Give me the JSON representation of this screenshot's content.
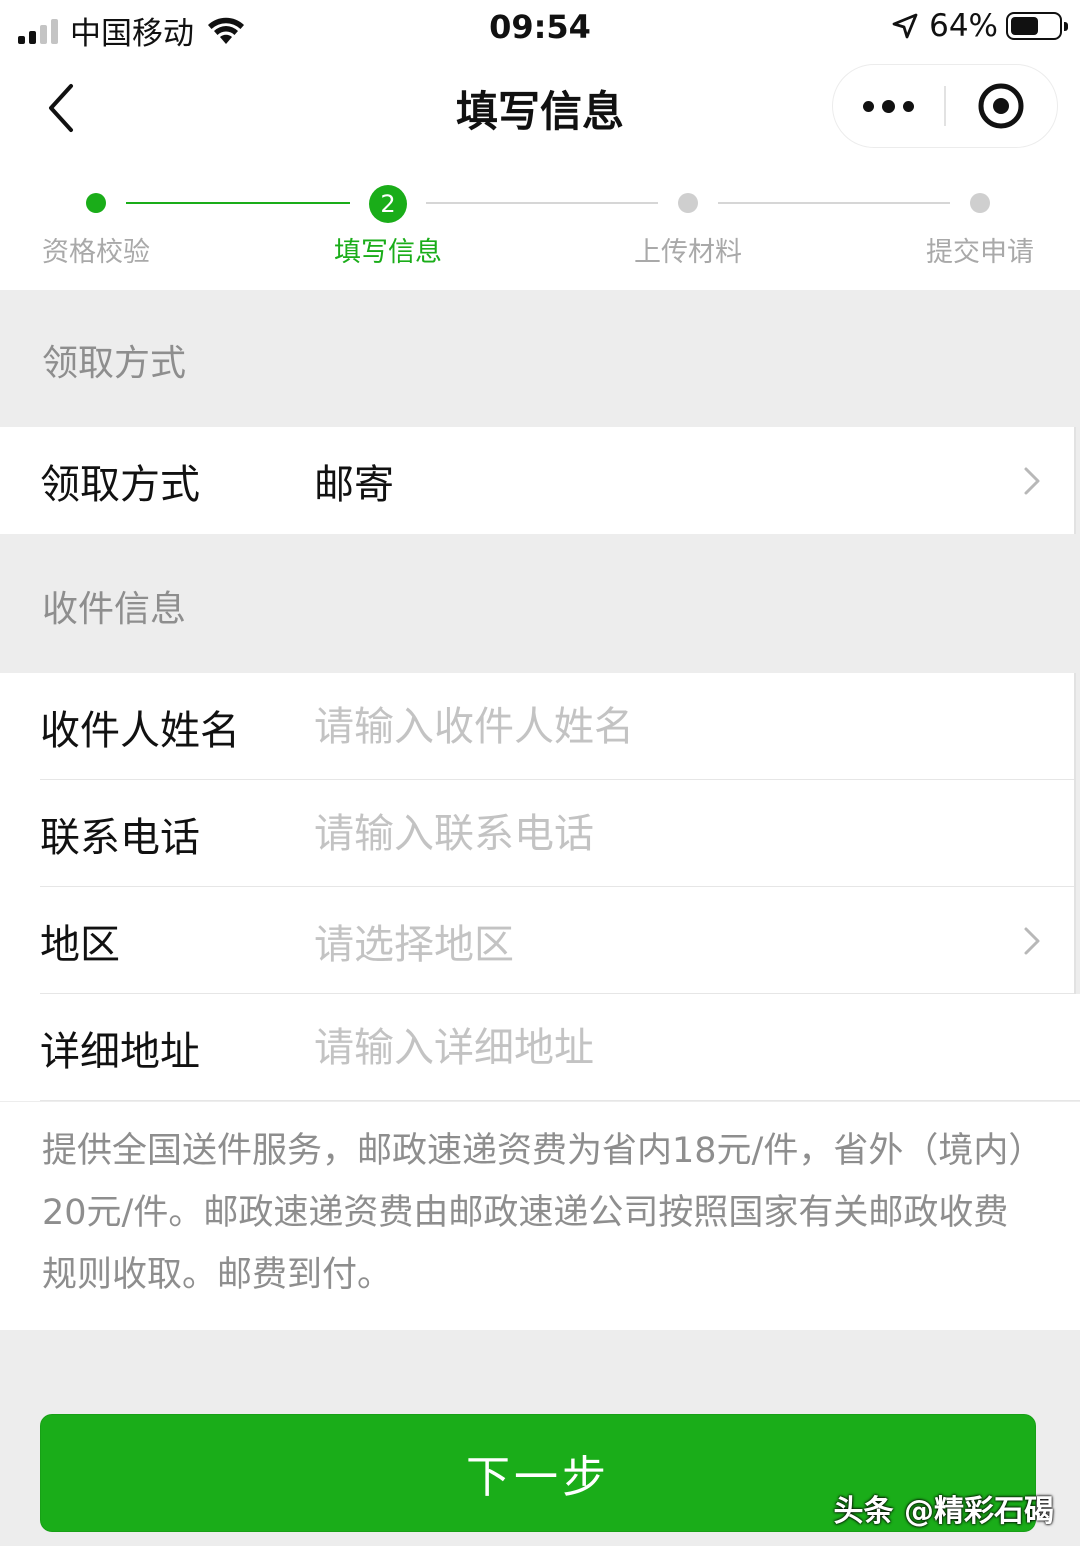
{
  "status_bar": {
    "carrier": "中国移动",
    "time": "09:54",
    "battery": "64%",
    "battery_level": 0.64
  },
  "nav": {
    "title": "填写信息"
  },
  "stepper": {
    "steps": [
      {
        "label": "资格校验",
        "state": "done"
      },
      {
        "label": "填写信息",
        "state": "current",
        "number": "2"
      },
      {
        "label": "上传材料",
        "state": "todo"
      },
      {
        "label": "提交申请",
        "state": "todo"
      }
    ],
    "active_color": "#1aad19",
    "inactive_color": "#cfcfcf"
  },
  "pickup_section": {
    "header": "领取方式",
    "row": {
      "label": "领取方式",
      "value": "邮寄"
    }
  },
  "recipient_section": {
    "header": "收件信息",
    "name": {
      "label": "收件人姓名",
      "placeholder": "请输入收件人姓名"
    },
    "phone": {
      "label": "联系电话",
      "placeholder": "请输入联系电话"
    },
    "region": {
      "label": "地区",
      "placeholder": "请选择地区"
    },
    "address": {
      "label": "详细地址",
      "placeholder": "请输入详细地址"
    }
  },
  "notice": {
    "text": "提供全国送件服务，邮政速递资费为省内18元/件，省外（境内）20元/件。邮政速递资费由邮政速递公司按照国家有关邮政收费规则收取。邮费到付。"
  },
  "actions": {
    "next_label": "下一步"
  },
  "watermark": "头条 @精彩石碣"
}
